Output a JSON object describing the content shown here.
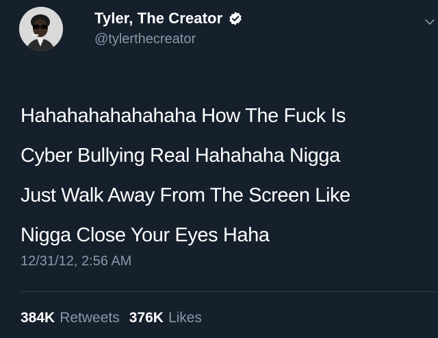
{
  "tweet": {
    "author": {
      "display_name": "Tyler, The Creator",
      "handle": "@tylerthecreator",
      "verified": true,
      "avatar_icon": "profile-photo-icon",
      "verified_icon": "verified-badge-icon"
    },
    "text": "Hahahahahahahaha How The Fuck Is\nCyber Bullying Real Hahahaha Nigga\nJust Walk Away From The Screen Like\nNigga Close Your Eyes Haha",
    "timestamp": "12/31/12, 2:56 AM",
    "stats": {
      "retweets_count": "384K",
      "retweets_label": "Retweets",
      "likes_count": "376K",
      "likes_label": "Likes"
    },
    "menu_icon": "chevron-down-icon"
  },
  "colors": {
    "background": "#161f2c",
    "secondary_text": "#8899a6",
    "primary_text": "#ffffff",
    "divider": "#2f3b48"
  }
}
